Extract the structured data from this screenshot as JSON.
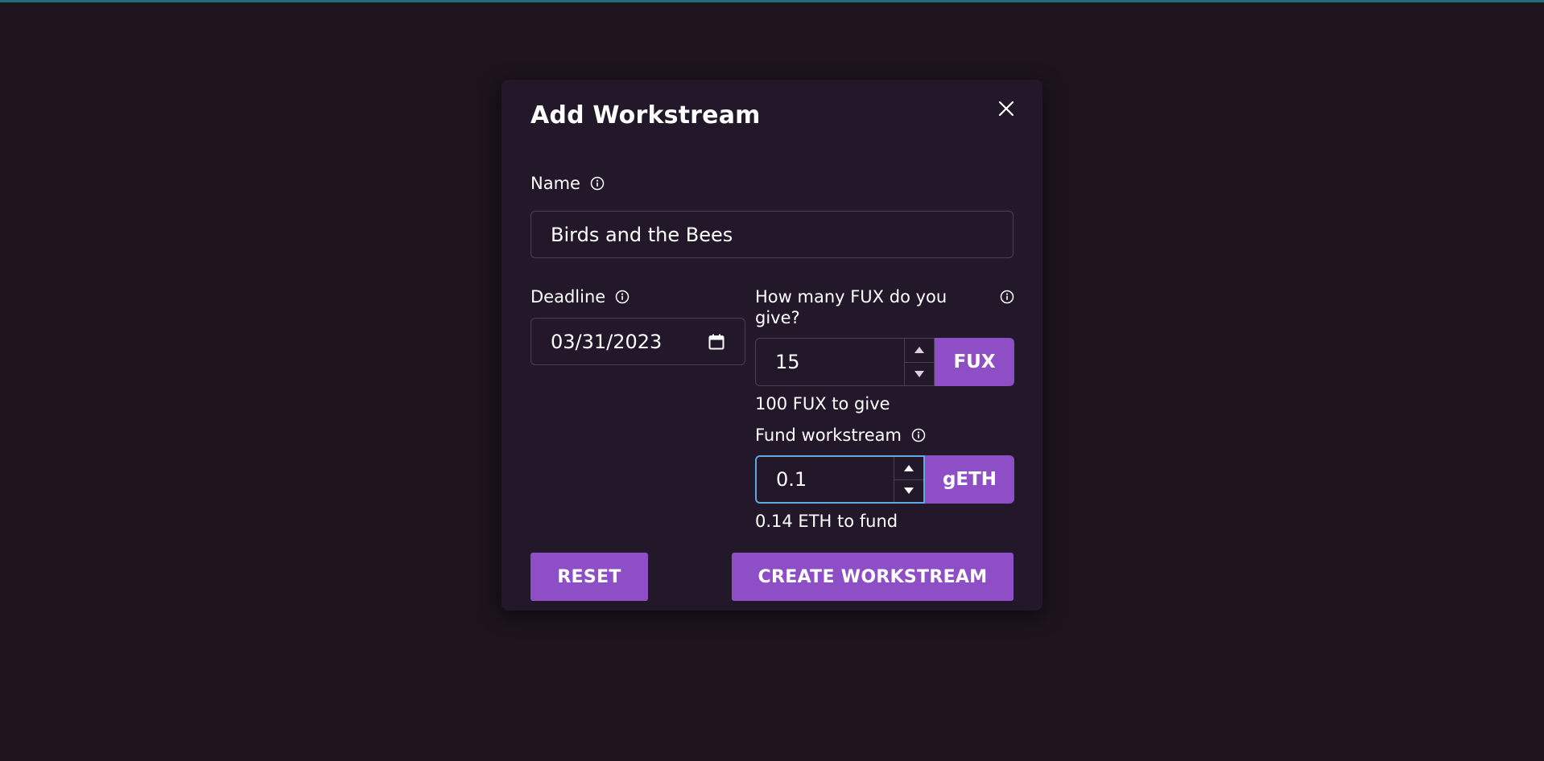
{
  "modal": {
    "title": "Add Workstream",
    "close_icon": "close-icon"
  },
  "name": {
    "label": "Name",
    "value": "Birds and the Bees"
  },
  "deadline": {
    "label": "Deadline",
    "value": "03/31/2023"
  },
  "fux": {
    "label": "How many FUX do you give?",
    "value": "15",
    "unit": "FUX",
    "hint": "100 FUX to give"
  },
  "fund": {
    "label": "Fund workstream",
    "value": "0.1",
    "unit": "gETH",
    "hint": "0.14 ETH to fund"
  },
  "actions": {
    "reset_label": "RESET",
    "create_label": "CREATE WORKSTREAM"
  },
  "colors": {
    "background": "#1d141d",
    "modal": "#22182a",
    "accent": "#8e4fc6",
    "focus": "#61a8e0"
  }
}
